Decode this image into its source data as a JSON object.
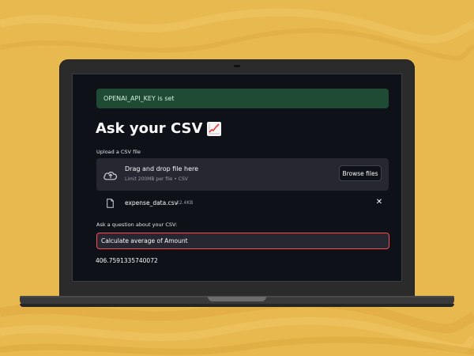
{
  "colors": {
    "background": "#e8b94f",
    "app_bg": "#0e1117",
    "success_bg": "#1f4a33",
    "input_border": "#ff4b4b"
  },
  "alert": {
    "text": "OPENAI_API_KEY is set"
  },
  "page": {
    "title": "Ask your CSV",
    "title_icon": "chart-increasing-icon"
  },
  "uploader": {
    "label": "Upload a CSV file",
    "drop_text": "Drag and drop file here",
    "limit_text": "Limit 200MB per file • CSV",
    "browse_label": "Browse files",
    "icon": "cloud-upload-icon"
  },
  "uploaded_file": {
    "name": "expense_data.csv",
    "size": "22.4KB",
    "icon": "file-icon",
    "remove_icon": "close-icon"
  },
  "question": {
    "label": "Ask a question about your CSV:",
    "value": "Calculate average of Amount"
  },
  "answer": {
    "text": "406.7591335740072"
  }
}
